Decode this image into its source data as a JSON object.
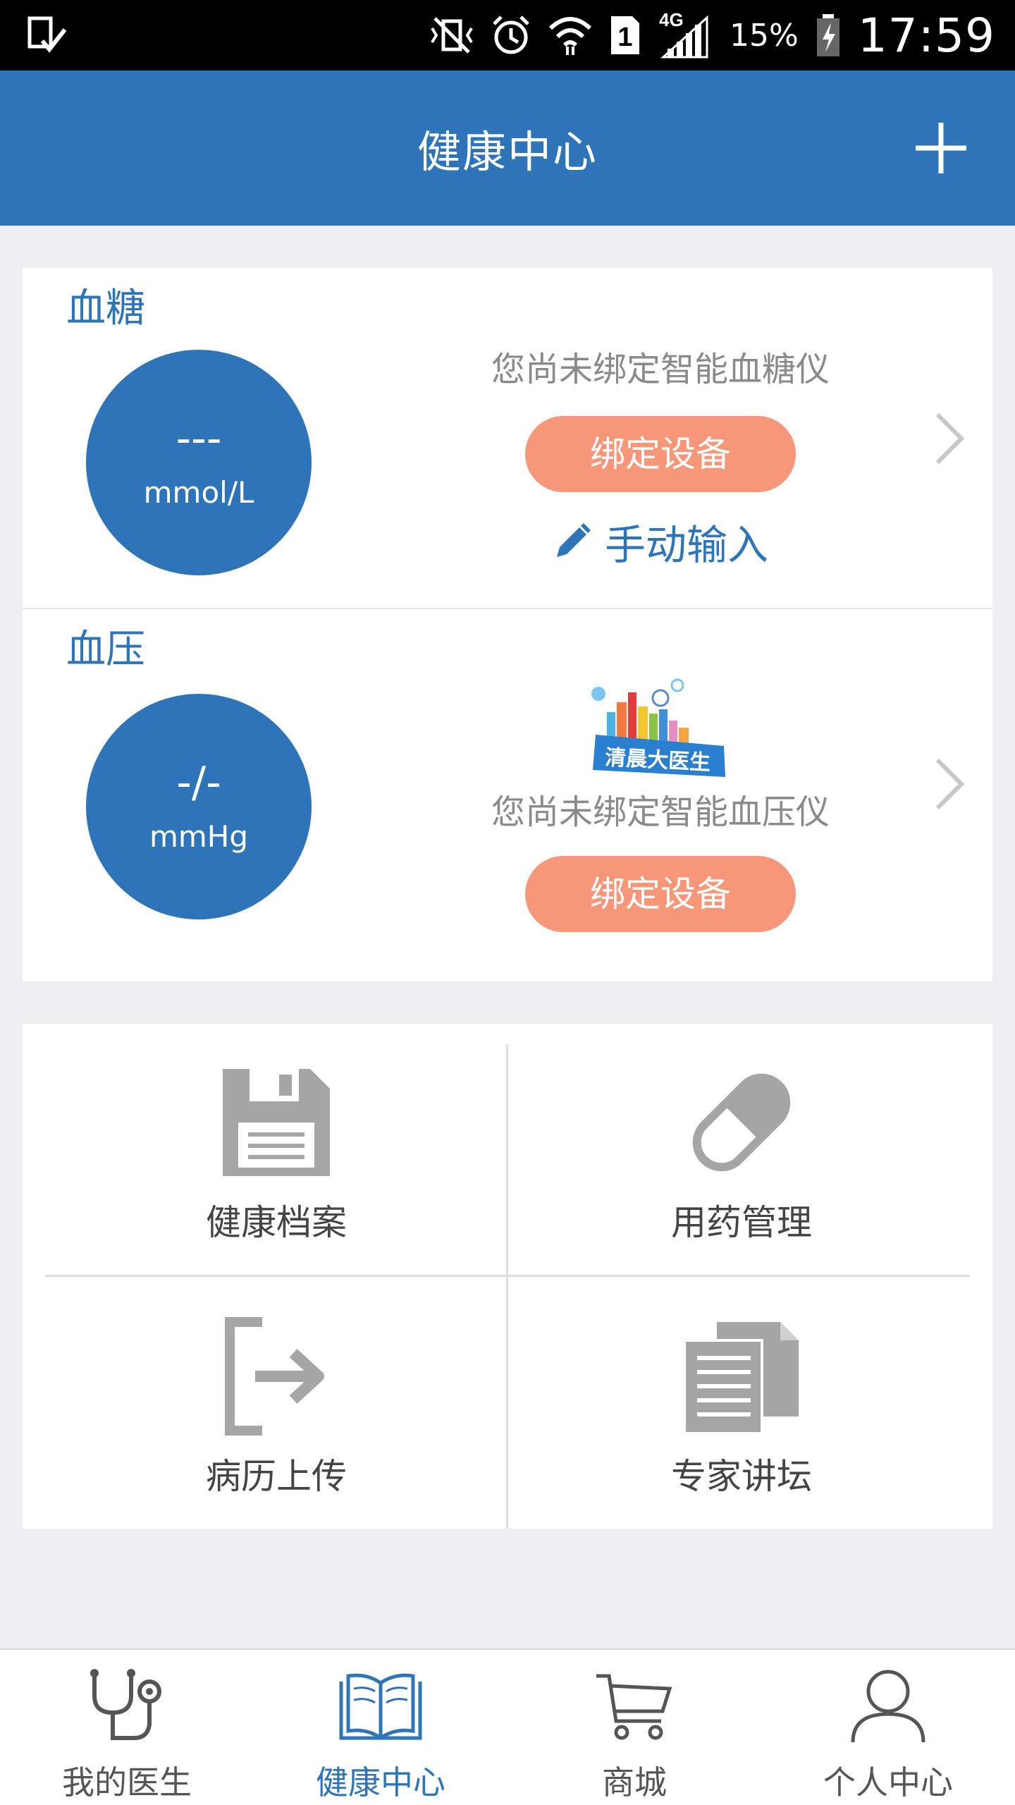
{
  "status_bar": {
    "battery_percent": "15%",
    "time": "17:59",
    "network": "4G",
    "sim": "1"
  },
  "header": {
    "title": "健康中心",
    "add_icon": "plus-icon"
  },
  "blood_sugar": {
    "title": "血糖",
    "value": "---",
    "unit": "mmol/L",
    "hint": "您尚未绑定智能血糖仪",
    "bind_label": "绑定设备",
    "manual_label": "手动输入"
  },
  "blood_pressure": {
    "title": "血压",
    "value": "-/-",
    "unit": "mmHg",
    "logo_text": "清晨大医生",
    "hint": "您尚未绑定智能血压仪",
    "bind_label": "绑定设备"
  },
  "grid": [
    {
      "label": "健康档案",
      "icon": "floppy-disk-icon"
    },
    {
      "label": "用药管理",
      "icon": "pill-icon"
    },
    {
      "label": "病历上传",
      "icon": "upload-exit-icon"
    },
    {
      "label": "专家讲坛",
      "icon": "documents-icon"
    }
  ],
  "bottom_nav": [
    {
      "label": "我的医生",
      "icon": "stethoscope-icon",
      "active": false
    },
    {
      "label": "健康中心",
      "icon": "book-icon",
      "active": true
    },
    {
      "label": "商城",
      "icon": "cart-icon",
      "active": false
    },
    {
      "label": "个人中心",
      "icon": "person-icon",
      "active": false
    }
  ],
  "colors": {
    "primary": "#2e74b8",
    "accent": "#f7977a",
    "background": "#eeeef3"
  }
}
